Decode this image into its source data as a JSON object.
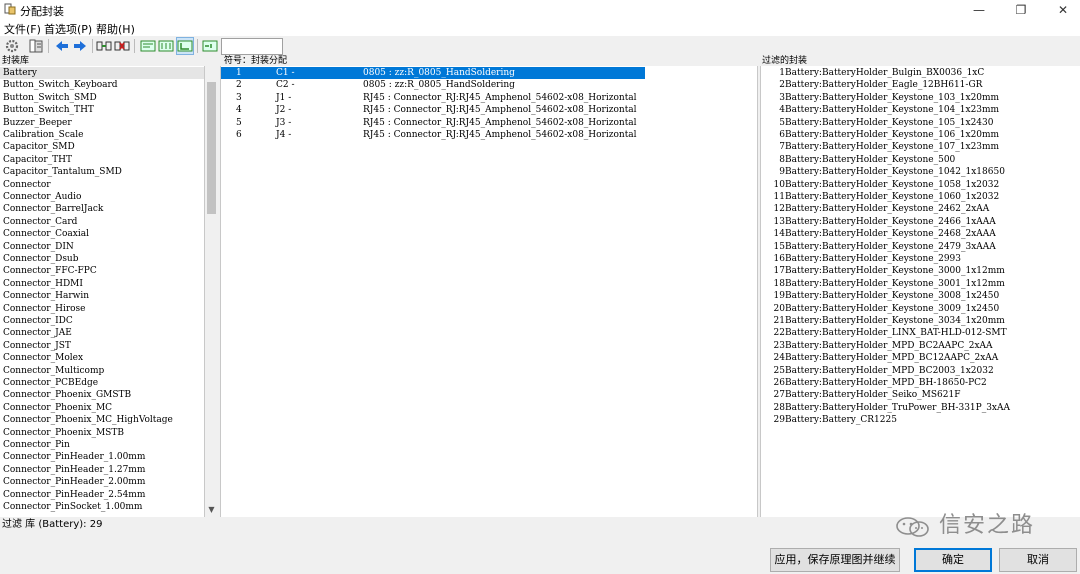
{
  "window": {
    "title": "分配封装",
    "minimize_glyph": "—",
    "maximize_glyph": "❐",
    "close_glyph": "✕"
  },
  "menu": [
    "文件(F)",
    "首选项(P)",
    "帮助(H)"
  ],
  "toolbar": {
    "icons": [
      "gear-icon",
      "library-icon",
      "arrow-left-icon",
      "arrow-right-icon",
      "associate-icon",
      "delete-association-icon",
      "filter-by-keywords-icon",
      "filter-by-pin-count-icon",
      "filter-by-library-icon",
      "filter-text-icon"
    ],
    "filter_value": ""
  },
  "library_panel": {
    "header": "封装库",
    "items": [
      "Battery",
      "Button_Switch_Keyboard",
      "Button_Switch_SMD",
      "Button_Switch_THT",
      "Buzzer_Beeper",
      "Calibration_Scale",
      "Capacitor_SMD",
      "Capacitor_THT",
      "Capacitor_Tantalum_SMD",
      "Connector",
      "Connector_Audio",
      "Connector_BarrelJack",
      "Connector_Card",
      "Connector_Coaxial",
      "Connector_DIN",
      "Connector_Dsub",
      "Connector_FFC-FPC",
      "Connector_HDMI",
      "Connector_Harwin",
      "Connector_Hirose",
      "Connector_IDC",
      "Connector_JAE",
      "Connector_JST",
      "Connector_Molex",
      "Connector_Multicomp",
      "Connector_PCBEdge",
      "Connector_Phoenix_GMSTB",
      "Connector_Phoenix_MC",
      "Connector_Phoenix_MC_HighVoltage",
      "Connector_Phoenix_MSTB",
      "Connector_Pin",
      "Connector_PinHeader_1.00mm",
      "Connector_PinHeader_1.27mm",
      "Connector_PinHeader_2.00mm",
      "Connector_PinHeader_2.54mm",
      "Connector_PinSocket_1.00mm"
    ],
    "selected_index": 0
  },
  "assign_panel": {
    "header": "符号：封装分配",
    "rows": [
      {
        "idx": "1",
        "ref": "C1 -",
        "fp": "0805 : zz:R_0805_HandSoldering"
      },
      {
        "idx": "2",
        "ref": "C2 -",
        "fp": "0805 : zz:R_0805_HandSoldering"
      },
      {
        "idx": "3",
        "ref": "J1 -",
        "fp": "RJ45 : Connector_RJ:RJ45_Amphenol_54602-x08_Horizontal"
      },
      {
        "idx": "4",
        "ref": "J2 -",
        "fp": "RJ45 : Connector_RJ:RJ45_Amphenol_54602-x08_Horizontal"
      },
      {
        "idx": "5",
        "ref": "J3 -",
        "fp": "RJ45 : Connector_RJ:RJ45_Amphenol_54602-x08_Horizontal"
      },
      {
        "idx": "6",
        "ref": "J4 -",
        "fp": "RJ45 : Connector_RJ:RJ45_Amphenol_54602-x08_Horizontal"
      }
    ],
    "selected_index": 0
  },
  "filtered_panel": {
    "header": "过滤的封装",
    "items": [
      "Battery:BatteryHolder_Bulgin_BX0036_1xC",
      "Battery:BatteryHolder_Eagle_12BH611-GR",
      "Battery:BatteryHolder_Keystone_103_1x20mm",
      "Battery:BatteryHolder_Keystone_104_1x23mm",
      "Battery:BatteryHolder_Keystone_105_1x2430",
      "Battery:BatteryHolder_Keystone_106_1x20mm",
      "Battery:BatteryHolder_Keystone_107_1x23mm",
      "Battery:BatteryHolder_Keystone_500",
      "Battery:BatteryHolder_Keystone_1042_1x18650",
      "Battery:BatteryHolder_Keystone_1058_1x2032",
      "Battery:BatteryHolder_Keystone_1060_1x2032",
      "Battery:BatteryHolder_Keystone_2462_2xAA",
      "Battery:BatteryHolder_Keystone_2466_1xAAA",
      "Battery:BatteryHolder_Keystone_2468_2xAAA",
      "Battery:BatteryHolder_Keystone_2479_3xAAA",
      "Battery:BatteryHolder_Keystone_2993",
      "Battery:BatteryHolder_Keystone_3000_1x12mm",
      "Battery:BatteryHolder_Keystone_3001_1x12mm",
      "Battery:BatteryHolder_Keystone_3008_1x2450",
      "Battery:BatteryHolder_Keystone_3009_1x2450",
      "Battery:BatteryHolder_Keystone_3034_1x20mm",
      "Battery:BatteryHolder_LINX_BAT-HLD-012-SMT",
      "Battery:BatteryHolder_MPD_BC2AAPC_2xAA",
      "Battery:BatteryHolder_MPD_BC12AAPC_2xAA",
      "Battery:BatteryHolder_MPD_BC2003_1x2032",
      "Battery:BatteryHolder_MPD_BH-18650-PC2",
      "Battery:BatteryHolder_Seiko_MS621F",
      "Battery:BatteryHolder_TruPower_BH-331P_3xAA",
      "Battery:Battery_CR1225"
    ]
  },
  "status_text": "过滤 库 (Battery): 29",
  "buttons": {
    "apply": "应用，保存原理图并继续",
    "ok": "确定",
    "cancel": "取消"
  },
  "watermark": "信安之路",
  "colors": {
    "selection": "#0078d7",
    "arrow": "#1e6fd9",
    "green": "#2e8b2e",
    "red": "#c81e1e"
  }
}
